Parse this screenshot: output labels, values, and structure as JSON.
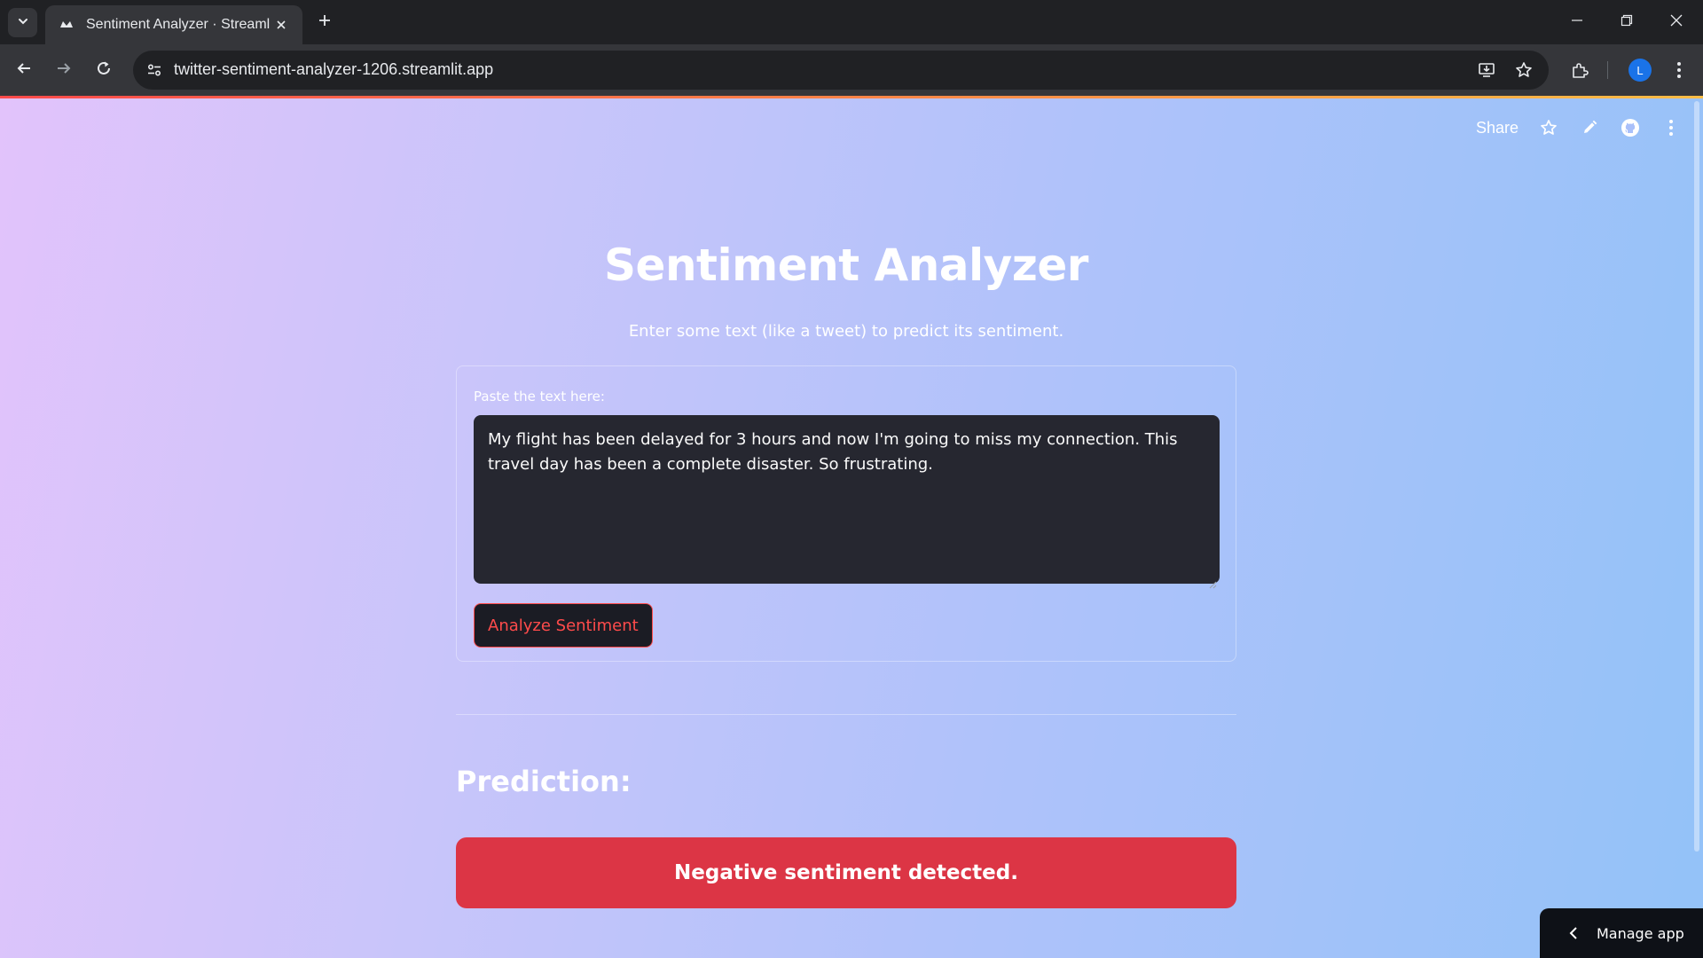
{
  "browser": {
    "tab_title": "Sentiment Analyzer · Streamlit",
    "url": "twitter-sentiment-analyzer-1206.streamlit.app",
    "profile_initial": "L"
  },
  "header": {
    "share_label": "Share"
  },
  "main": {
    "title": "Sentiment Analyzer",
    "subtitle": "Enter some text (like a tweet) to predict its sentiment.",
    "input_label": "Paste the text here:",
    "input_value": "My flight has been delayed for 3 hours and now I'm going to miss my connection. This travel day has been a complete disaster. So frustrating.",
    "analyze_button": "Analyze Sentiment",
    "prediction_heading": "Prediction:",
    "result_text": "Negative sentiment detected."
  },
  "footer": {
    "manage_app_label": "Manage app"
  },
  "colors": {
    "accent": "#ff4b4b",
    "result_bg": "#dc3545",
    "input_bg": "#262730"
  }
}
